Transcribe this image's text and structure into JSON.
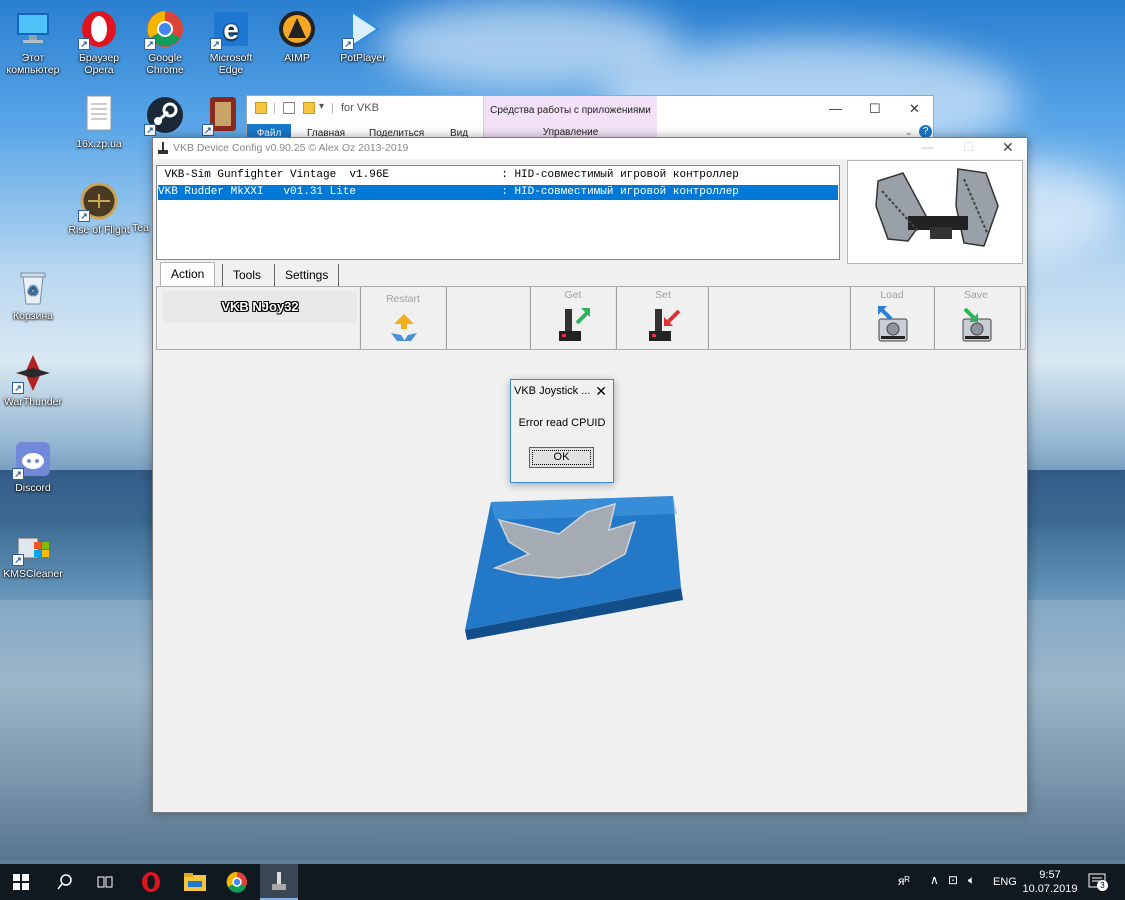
{
  "desktop": {
    "icons": [
      {
        "label": "Этот\nкомпьютер"
      },
      {
        "label": "Браузер\nOpera"
      },
      {
        "label": "Google\nChrome"
      },
      {
        "label": "Microsoft\nEdge"
      },
      {
        "label": "AIMP"
      },
      {
        "label": "PotPlayer"
      },
      {
        "label": "16x.zp.ua"
      },
      {
        "label": "Rise of Flight"
      },
      {
        "label": "Tea"
      },
      {
        "label": "Корзина"
      },
      {
        "label": "WarThunder"
      },
      {
        "label": "Discord"
      },
      {
        "label": "KMSCleaner"
      }
    ]
  },
  "explorer": {
    "path": "for VKB",
    "context_tab": "Средства работы с приложениями",
    "context_sub": "Управление",
    "ribbon": [
      "Файл",
      "Главная",
      "Поделиться",
      "Вид"
    ],
    "min": "—",
    "max": "☐",
    "close": "✕",
    "help": "?"
  },
  "app": {
    "title": "VKB Device Config v0.90.25  © Alex Oz 2013-2019",
    "devices": [
      " VKB-Sim Gunfighter Vintage  v1.96E                 : HID-совместимый игровой контроллер",
      "VKB Rudder MkXXI   v01.31 Lite                      : HID-совместимый игровой контроллер"
    ],
    "tabs": [
      "Action",
      "Tools",
      "Settings"
    ],
    "device_name": "VKB NJoy32",
    "toolbar": {
      "restart": "Restart",
      "get": "Get",
      "set": "Set",
      "load": "Load",
      "save": "Save"
    }
  },
  "dialog": {
    "title": "VKB Joystick ...",
    "message": "Error read CPUID",
    "ok": "OK"
  },
  "taskbar": {
    "lang": "ENG",
    "time": "9:57",
    "date": "10.07.2019",
    "notifications": "3"
  }
}
